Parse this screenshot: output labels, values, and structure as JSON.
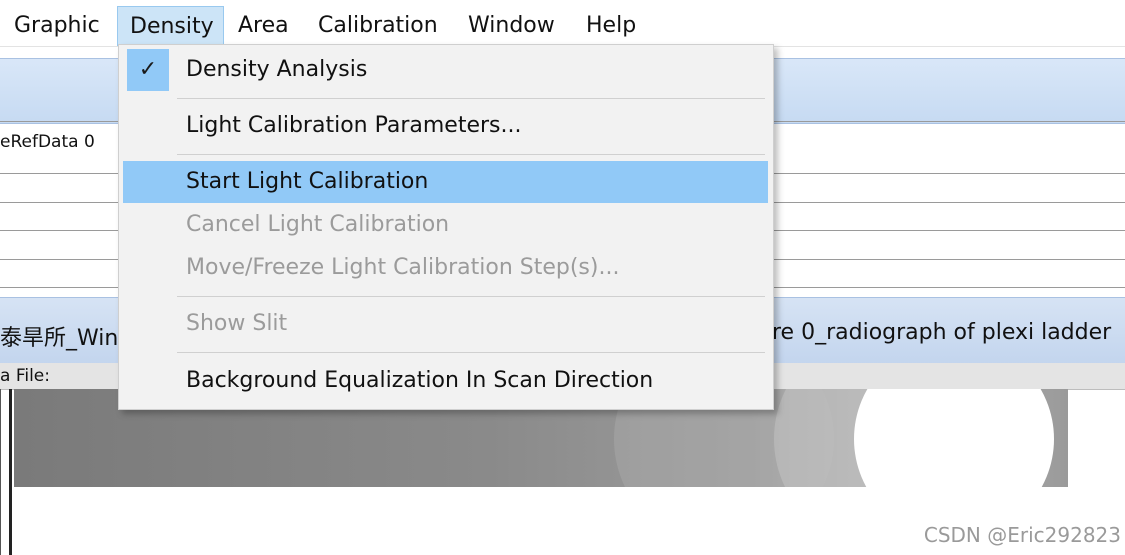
{
  "menubar": {
    "items": [
      "Graphic",
      "Density",
      "Area",
      "Calibration",
      "Window",
      "Help"
    ],
    "active": "Density"
  },
  "background": {
    "refdata_text": "eRefData  0",
    "title_left": "泰旱所_WinD",
    "title_right": "re 0_radiograph of plexi ladder",
    "file_label": "a File:"
  },
  "density_menu": {
    "items": [
      {
        "label": "Density Analysis",
        "checked": true,
        "state": "normal"
      },
      {
        "label": "Light Calibration Parameters...",
        "state": "normal"
      },
      {
        "label": "Start Light Calibration",
        "state": "highlighted"
      },
      {
        "label": "Cancel Light Calibration",
        "state": "disabled"
      },
      {
        "label": "Move/Freeze Light Calibration Step(s)...",
        "state": "disabled"
      },
      {
        "label": "Show Slit",
        "state": "disabled"
      },
      {
        "label": "Background Equalization In Scan Direction",
        "state": "normal"
      }
    ]
  },
  "watermark": "CSDN @Eric292823",
  "colors": {
    "menu_highlight": "#91c9f7",
    "menubar_active_bg": "#cce4f7",
    "disabled_text": "#9b9b9b",
    "title_bar": "#c6daf2"
  },
  "icons": {
    "check": "checkmark-icon"
  }
}
